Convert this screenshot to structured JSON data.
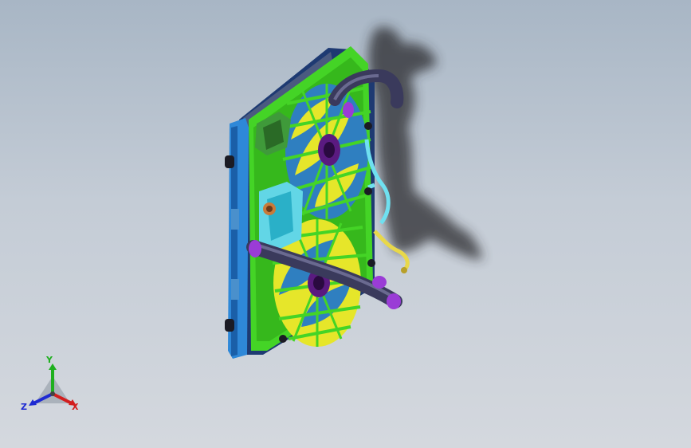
{
  "viewport": {
    "background_top": "#a8b6c5",
    "background_bottom": "#d4d8de"
  },
  "model": {
    "name": "radiator-fan-assembly",
    "colors": {
      "radiator_frame": "#2e88d8",
      "shroud": "#44d426",
      "fan_blades": "#e6e62a",
      "fan_blade_alt": "#2f7fc0",
      "hose": "#3a3a5c",
      "hose_clamp": "#9a3cd6",
      "coolant_line": "#6fe0f0",
      "yellow_line": "#e8d84a",
      "motor_housing": "#62d6e6",
      "shadow": "#2a2a2e"
    }
  },
  "triad": {
    "x_label": "X",
    "y_label": "Y",
    "z_label": "Z",
    "x_color": "#d21e1e",
    "y_color": "#1fb01f",
    "z_color": "#1e2ad2"
  }
}
